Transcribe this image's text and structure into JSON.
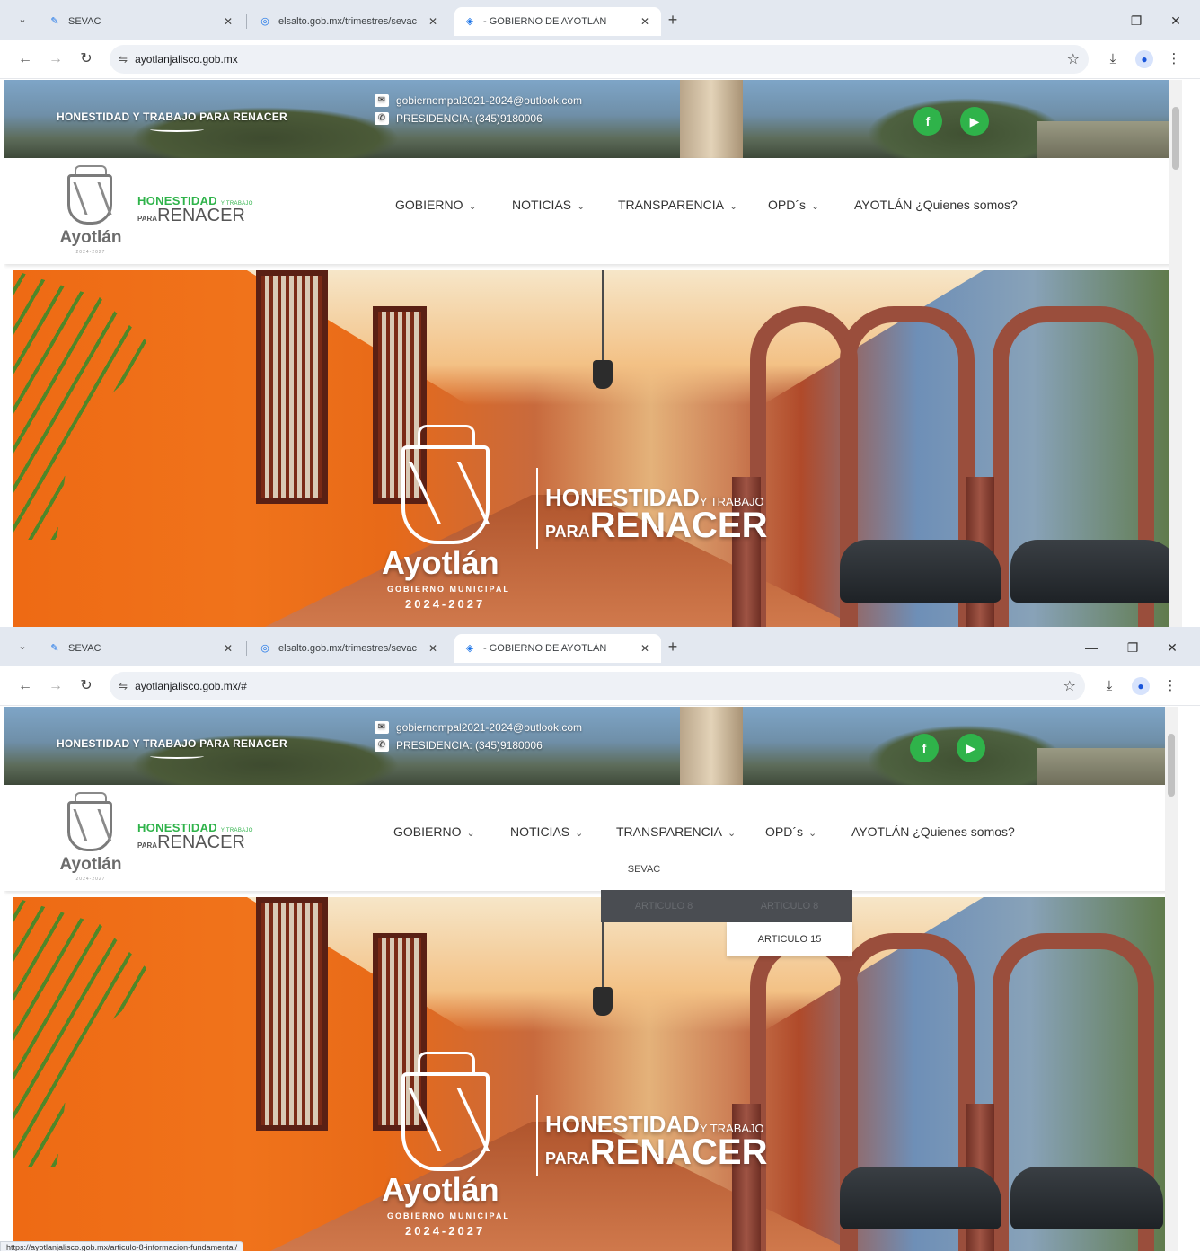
{
  "browser": {
    "tabs": [
      {
        "title": "SEVAC",
        "active": false,
        "favicon": "sevac-icon"
      },
      {
        "title": "elsalto.gob.mx/trimestres/sevac",
        "active": false,
        "favicon": "globe-icon"
      },
      {
        "title": "- GOBIERNO DE AYOTLÁN",
        "active": true,
        "favicon": "site-icon"
      }
    ],
    "new_tab": "+",
    "window_controls": {
      "minimize": "—",
      "restore": "❐",
      "close": "✕"
    }
  },
  "screenshots": [
    {
      "url": "ayotlanjalisco.gob.mx",
      "dropdown_open": false
    },
    {
      "url": "ayotlanjalisco.gob.mx/#",
      "dropdown_open": true
    }
  ],
  "site": {
    "topbar": {
      "slogan": "HONESTIDAD Y TRABAJO PARA RENACER",
      "email": "gobiernompal2021-2024@outlook.com",
      "phone": "PRESIDENCIA: (345)9180006",
      "social": [
        {
          "name": "facebook",
          "glyph": "f"
        },
        {
          "name": "youtube",
          "glyph": "▶"
        }
      ]
    },
    "logo": {
      "name": "Ayotlán",
      "sub": "GOBIERNO MUNICIPAL",
      "years": "2024-2027"
    },
    "brand": {
      "line1_big": "HONESTIDAD",
      "line1_small": "Y TRABAJO",
      "line2_small": "PARA",
      "line2_big": "RENACER"
    },
    "menu": [
      {
        "label": "GOBIERNO",
        "has_dropdown": true
      },
      {
        "label": "NOTICIAS",
        "has_dropdown": true
      },
      {
        "label": "TRANSPARENCIA",
        "has_dropdown": true
      },
      {
        "label": "OPD´s",
        "has_dropdown": true
      },
      {
        "label": "AYOTLÁN ¿Quienes somos?",
        "has_dropdown": false
      }
    ],
    "dropdown": {
      "first_item": "SEVAC",
      "row_items": [
        "ARTICULO 8",
        "ARTICULO 8"
      ],
      "submenu_item": "ARTICULO 15"
    },
    "hero": {
      "name": "Ayotlán",
      "sub": "GOBIERNO MUNICIPAL",
      "years": "2024-2027",
      "tagline_big": "HONESTIDAD",
      "tagline_small": "Y TRABAJO",
      "tagline2_small": "PARA",
      "tagline2_big": "RENACER"
    },
    "status_url": "https://ayotlanjalisco.gob.mx/articulo-8-informacion-fundamental/"
  },
  "colors": {
    "accent_green": "#2fb34a",
    "hero_orange": "#ee6a14",
    "dropdown_dark": "#4a4d52"
  }
}
